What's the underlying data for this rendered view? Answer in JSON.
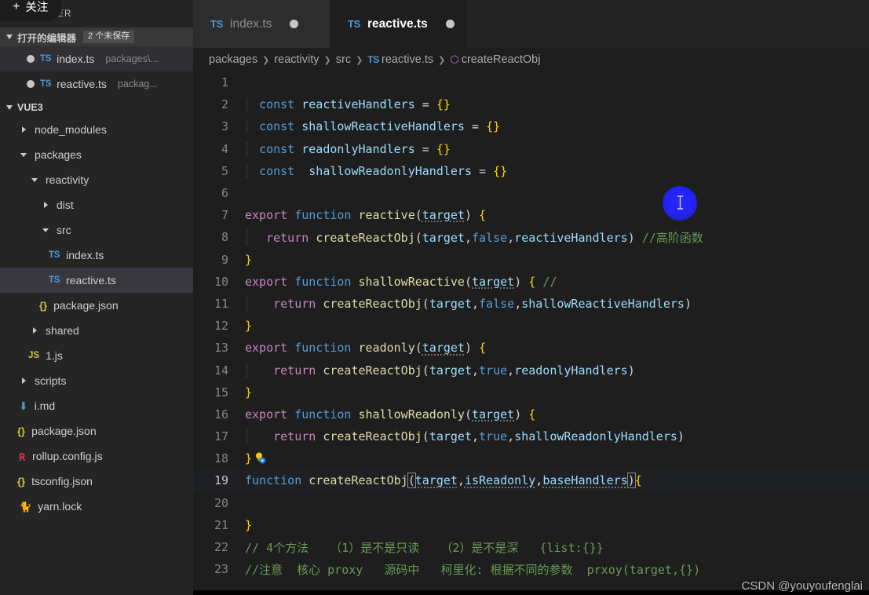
{
  "overlay": {
    "follow_label": "关注",
    "follow_plus": "+",
    "watermark": "CSDN @youyoufenglai"
  },
  "sidebar": {
    "title": "EXPLORER",
    "open_editors": {
      "label": "打开的编辑器",
      "badge": "2 个未保存",
      "items": [
        {
          "icon": "typescript-icon",
          "name": "index.ts",
          "path": "packages\\...",
          "dirty": true,
          "selected": true
        },
        {
          "icon": "typescript-icon",
          "name": "reactive.ts",
          "path": "packag...",
          "dirty": true,
          "selected": false
        }
      ]
    },
    "project": {
      "label": "VUE3",
      "tree": [
        {
          "kind": "folder",
          "name": "node_modules",
          "expanded": false,
          "depth": 1
        },
        {
          "kind": "folder",
          "name": "packages",
          "expanded": true,
          "depth": 1
        },
        {
          "kind": "folder",
          "name": "reactivity",
          "expanded": true,
          "depth": 2
        },
        {
          "kind": "folder",
          "name": "dist",
          "expanded": false,
          "depth": 3
        },
        {
          "kind": "folder",
          "name": "src",
          "expanded": true,
          "depth": 3
        },
        {
          "kind": "ts",
          "name": "index.ts",
          "depth": 4,
          "selected": false
        },
        {
          "kind": "ts",
          "name": "reactive.ts",
          "depth": 4,
          "selected": true
        },
        {
          "kind": "json",
          "name": "package.json",
          "depth": 3
        },
        {
          "kind": "folder",
          "name": "shared",
          "expanded": false,
          "depth": 2
        },
        {
          "kind": "js",
          "name": "1.js",
          "depth": 2
        },
        {
          "kind": "folder",
          "name": "scripts",
          "expanded": false,
          "depth": 1
        },
        {
          "kind": "md",
          "name": "i.md",
          "depth": 1
        },
        {
          "kind": "json",
          "name": "package.json",
          "depth": 1
        },
        {
          "kind": "rollup",
          "name": "rollup.config.js",
          "depth": 1
        },
        {
          "kind": "json",
          "name": "tsconfig.json",
          "depth": 1
        },
        {
          "kind": "yarn",
          "name": "yarn.lock",
          "depth": 1
        }
      ]
    }
  },
  "tabs": [
    {
      "icon": "typescript-icon",
      "label": "index.ts",
      "dirty": true,
      "active": false
    },
    {
      "icon": "typescript-icon",
      "label": "reactive.ts",
      "dirty": true,
      "active": true
    }
  ],
  "breadcrumb": [
    {
      "text": "packages",
      "icon": null
    },
    {
      "text": "reactivity",
      "icon": null
    },
    {
      "text": "src",
      "icon": null
    },
    {
      "text": "reactive.ts",
      "icon": "typescript-icon"
    },
    {
      "text": "createReactObj",
      "icon": "symbol-cube-icon"
    }
  ],
  "editor": {
    "language": "TypeScript",
    "active_line": 19,
    "lines": [
      {
        "n": 1,
        "text": ""
      },
      {
        "n": 2,
        "text": "  const reactiveHandlers = {}"
      },
      {
        "n": 3,
        "text": "  const shallowReactiveHandlers = {}"
      },
      {
        "n": 4,
        "text": "  const readonlyHandlers = {}"
      },
      {
        "n": 5,
        "text": "  const  shallowReadonlyHandlers = {}"
      },
      {
        "n": 6,
        "text": ""
      },
      {
        "n": 7,
        "text": "export function reactive(target) {"
      },
      {
        "n": 8,
        "text": "   return createReactObj(target,false,reactiveHandlers) //高阶函数"
      },
      {
        "n": 9,
        "text": "}"
      },
      {
        "n": 10,
        "text": "export function shallowReactive(target) { //"
      },
      {
        "n": 11,
        "text": "    return createReactObj(target,false,shallowReactiveHandlers)"
      },
      {
        "n": 12,
        "text": "}"
      },
      {
        "n": 13,
        "text": "export function readonly(target) {"
      },
      {
        "n": 14,
        "text": "    return createReactObj(target,true,readonlyHandlers)"
      },
      {
        "n": 15,
        "text": "}"
      },
      {
        "n": 16,
        "text": "export function shallowReadonly(target) {"
      },
      {
        "n": 17,
        "text": "    return createReactObj(target,true,shallowReadonlyHandlers)"
      },
      {
        "n": 18,
        "text": "}"
      },
      {
        "n": 19,
        "text": "function createReactObj(target,isReadonly,baseHandlers){"
      },
      {
        "n": 20,
        "text": ""
      },
      {
        "n": 21,
        "text": "}"
      },
      {
        "n": 22,
        "text": "// 4个方法   （1）是不是只读   （2）是不是深   {list:{}}"
      },
      {
        "n": 23,
        "text": "//注意  核心 proxy   源码中   柯里化: 根据不同的参数  prxoy(target,{})"
      }
    ],
    "comment_line8": "//高阶函数",
    "comment_line10": "//",
    "comment_line22": "// 4个方法   （1）是不是只读   （2）是不是深   {list:{}}",
    "comment_line23": "//注意  核心 proxy   源码中   柯里化: 根据不同的参数  prxoy(target,{})",
    "quickfix_icon": "lightbulb-icon"
  },
  "colors": {
    "editor_bg": "#1e1e1e",
    "sidebar_bg": "#252526",
    "tab_inactive_bg": "#2d2d2d",
    "selection_bg": "#37373d",
    "keyword": "#569cd6",
    "keyword_control": "#c586c0",
    "function": "#dcdcaa",
    "variable": "#9cdcfe",
    "comment": "#6a9955",
    "line_number": "#858585",
    "cursor_blob": "#2222f5"
  }
}
